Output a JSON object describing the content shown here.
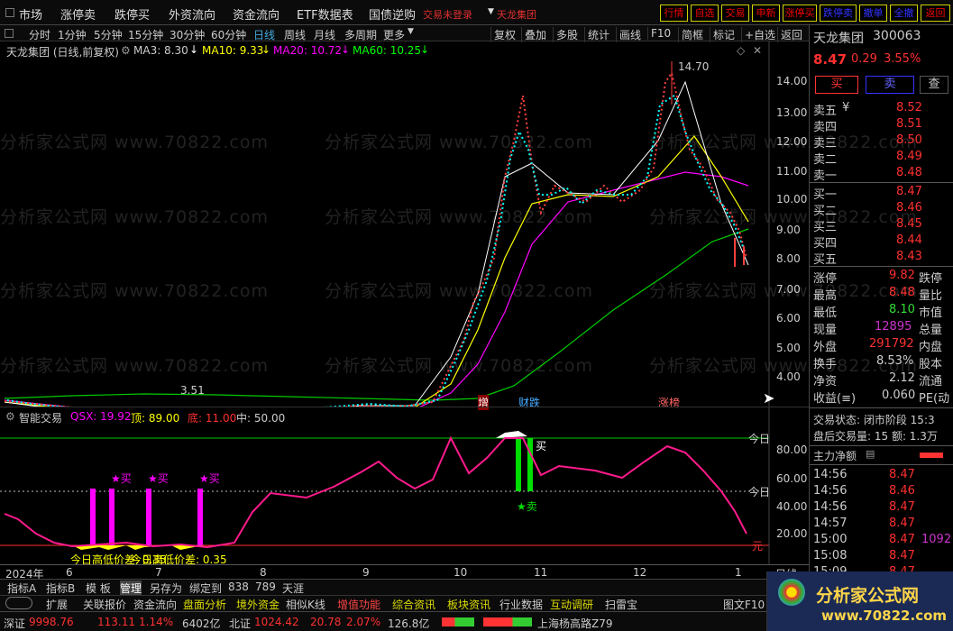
{
  "nav": {
    "items": [
      "市场",
      "涨停卖",
      "跌停买",
      "外资流向",
      "资金流向",
      "ETF数据表",
      "国债逆购"
    ],
    "trade_status": "交易未登录",
    "stock_link": "天龙集团"
  },
  "top_buttons": [
    "行情",
    "自选",
    "交易",
    "申新",
    "涨停买",
    "跌停卖",
    "撤单",
    "全撤",
    "返回"
  ],
  "timeframes": [
    "分时",
    "1分钟",
    "5分钟",
    "15分钟",
    "30分钟",
    "60分钟",
    "日线",
    "周线",
    "月线",
    "多周期",
    "更多"
  ],
  "toolbar_buttons": [
    "复权",
    "叠加",
    "多股",
    "统计",
    "画线",
    "F10",
    "简框",
    "标记",
    "+自选",
    "返回"
  ],
  "chart": {
    "title": "天龙集团 (日线,前复权)",
    "ma": [
      {
        "label": "MA3: 8.30",
        "color": "#ffffff"
      },
      {
        "label": "MA10: 9.33",
        "color": "#ffff00"
      },
      {
        "label": "MA20: 10.72",
        "color": "#ff00ff"
      },
      {
        "label": "MA60: 10.25",
        "color": "#00ff00"
      }
    ],
    "yticks": [
      "14.00",
      "13.00",
      "12.00",
      "11.00",
      "10.00",
      "9.00",
      "8.00",
      "7.00",
      "6.00",
      "5.00",
      "4.00"
    ],
    "high_label": "14.70",
    "low_label": "3.51",
    "events": [
      "增",
      "财跌",
      "涨榜"
    ],
    "watermark": "分析家公式网 www.70822.com"
  },
  "indicator": {
    "name": "智能交易",
    "qsx": "QSX: 19.92",
    "top": "顶: 89.00",
    "bottom": "底: 11.00",
    "mid": "中: 50.00",
    "yticks": [
      "80.00",
      "60.00",
      "40.00",
      "20.00"
    ],
    "buy_labels": [
      "★买",
      "★买",
      "★买"
    ],
    "sell_label": "★卖",
    "buy_text": "买",
    "today_label": "今日",
    "yuan_label": "元",
    "low_price_label1": "今日高低价差: 0.35",
    "low_price_label2": "今日高低价差: 0.35",
    "chart_data": {
      "type": "line",
      "name": "QSX",
      "x": [
        "2024-06",
        "2024-07",
        "2024-08",
        "2024-09",
        "2024-10",
        "2024-11",
        "2024-12",
        "2025-01"
      ],
      "values": [
        18,
        14,
        30,
        68,
        70,
        93,
        62,
        90,
        19.92
      ],
      "ylim": [
        0,
        100
      ]
    }
  },
  "dates": {
    "year": "2024年",
    "months": [
      "6",
      "7",
      "8",
      "9",
      "10",
      "11",
      "12",
      "1"
    ],
    "period": "日线"
  },
  "quote": {
    "name": "天龙集团",
    "code": "300063",
    "price": "8.47",
    "change": "0.29",
    "pct": "3.55%",
    "buy_btn": "买",
    "sell_btn": "卖",
    "search_btn": "查",
    "asks": [
      {
        "l": "卖五",
        "y": "¥",
        "p": "8.52"
      },
      {
        "l": "卖四",
        "y": "",
        "p": "8.51"
      },
      {
        "l": "卖三",
        "y": "",
        "p": "8.50"
      },
      {
        "l": "卖二",
        "y": "",
        "p": "8.49"
      },
      {
        "l": "卖一",
        "y": "",
        "p": "8.48"
      }
    ],
    "bids": [
      {
        "l": "买一",
        "p": "8.47"
      },
      {
        "l": "买二",
        "p": "8.46"
      },
      {
        "l": "买三",
        "p": "8.45"
      },
      {
        "l": "买四",
        "p": "8.44"
      },
      {
        "l": "买五",
        "p": "8.43"
      }
    ],
    "stats": [
      {
        "a": "涨停",
        "b": "9.82",
        "c": "跌停"
      },
      {
        "a": "最高",
        "b": "8.48",
        "c": "量比"
      },
      {
        "a": "最低",
        "b": "8.10",
        "c": "市值"
      },
      {
        "a": "现量",
        "b": "12895",
        "c": "总量"
      },
      {
        "a": "外盘",
        "b": "291792",
        "c": "内盘"
      },
      {
        "a": "换手",
        "b": "8.53%",
        "c": "股本"
      },
      {
        "a": "净资",
        "b": "2.12",
        "c": "流通"
      },
      {
        "a": "收益(≡)",
        "b": "0.060",
        "c": "PE(动"
      }
    ],
    "trade_state": "交易状态: 闭市阶段 15:3",
    "after_hours": "盘后交易量: 15  额: 1.3万",
    "main_net": "主力净额",
    "ticks": [
      {
        "t": "14:56",
        "p": "8.47"
      },
      {
        "t": "14:56",
        "p": "8.46"
      },
      {
        "t": "14:56",
        "p": "8.47"
      },
      {
        "t": "14:57",
        "p": "8.47"
      },
      {
        "t": "15:00",
        "p": "8.47",
        "v": "1092"
      },
      {
        "t": "15:08",
        "p": "8.47"
      },
      {
        "t": "15:09",
        "p": "8.47"
      }
    ]
  },
  "bottom_tabs": [
    "指标A",
    "指标B",
    "模 板",
    "管理",
    "另存为",
    "绑定到",
    "838",
    "789",
    "天涯"
  ],
  "bottom_tabs2": [
    "扩展",
    "关联报价",
    "资金流向",
    "盘面分析",
    "境外资金",
    "相似K线",
    "增值功能",
    "综合资讯",
    "板块资讯",
    "行业数据",
    "互动调研",
    "扫雷宝"
  ],
  "status": {
    "sz_label": "深证",
    "sz_val": "9998.76",
    "sz_chg": "113.11",
    "sz_pct": "1.14%",
    "sz_amt": "6402亿",
    "bz_label": "北证",
    "bz_val": "1024.42",
    "bz_chg": "20.78",
    "bz_pct": "2.07%",
    "bz_amt": "126.8亿",
    "addr": "上海杨高路Z79"
  },
  "pic_btn": "图文F10",
  "logo": {
    "title": "分析家公式网",
    "url": "www.70822.com"
  }
}
